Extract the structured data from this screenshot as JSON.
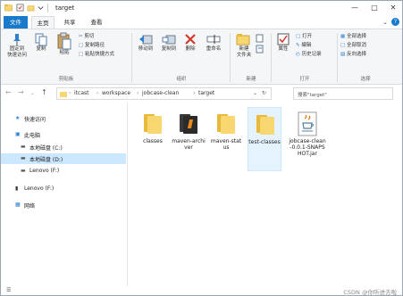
{
  "window": {
    "title": "target"
  },
  "tabs": [
    {
      "label": "文件"
    },
    {
      "label": "主页"
    },
    {
      "label": "共享"
    },
    {
      "label": "查看"
    }
  ],
  "ribbon": {
    "clipboard": {
      "pin": "固定到\n快速访问",
      "copy": "复制",
      "paste": "粘贴",
      "copy_path": "复制路径",
      "paste_shortcut": "粘贴快捷方式",
      "cut": "剪切",
      "group": "剪贴板"
    },
    "organize": {
      "move_to": "移动到",
      "copy_to": "复制到",
      "delete": "删除",
      "rename": "重命名",
      "group": "组织"
    },
    "new": {
      "new_folder": "新建\n文件夹",
      "group": "新建"
    },
    "open": {
      "properties": "属性",
      "open": "打开",
      "edit": "编辑",
      "history": "历史记录",
      "group": "打开"
    },
    "select": {
      "select_all": "全部选择",
      "select_none": "全部取消",
      "invert": "反向选择",
      "group": "选择"
    }
  },
  "address": {
    "crumbs": [
      "itcast",
      "workspace",
      "jobcase-clean",
      "target"
    ],
    "search_placeholder": "搜索\"target\""
  },
  "nav": [
    {
      "label": "快速访问"
    },
    {
      "label": "此电脑"
    },
    {
      "label": "本地磁盘 (C:)"
    },
    {
      "label": "本地磁盘 (D:)"
    },
    {
      "label": "Lenovo (F:)"
    },
    {
      "label": "Lenovo (F:)"
    },
    {
      "label": "网络"
    }
  ],
  "files": [
    {
      "name": "classes",
      "type": "folder"
    },
    {
      "name": "maven-archiver",
      "type": "folder-dark"
    },
    {
      "name": "maven-status",
      "type": "folder"
    },
    {
      "name": "test-classes",
      "type": "folder"
    },
    {
      "name": "jobcase-clean-0.0.1-SNAPSHOT.jar",
      "type": "jar"
    }
  ],
  "status": {
    "watermark": "CSDN @你听进去啦"
  },
  "colors": {
    "accent": "#1979ca",
    "folder": "#f8d670",
    "selection": "#cce8ff"
  }
}
